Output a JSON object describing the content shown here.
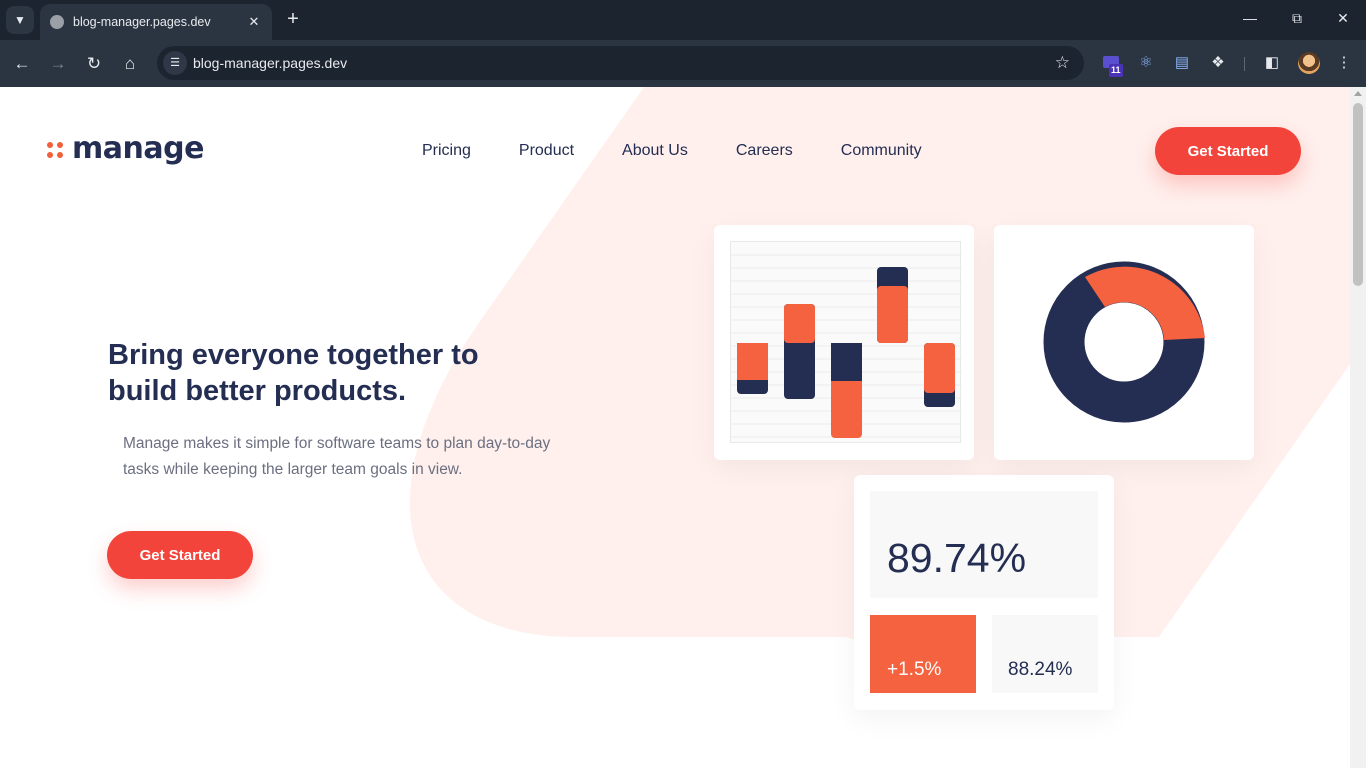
{
  "browser": {
    "tab_title": "blog-manager.pages.dev",
    "url": "blog-manager.pages.dev",
    "extension_badge": "11"
  },
  "header": {
    "logo_text": "manage",
    "nav": [
      "Pricing",
      "Product",
      "About Us",
      "Careers",
      "Community"
    ],
    "cta_label": "Get Started"
  },
  "hero": {
    "title": "Bring everyone together to build better products.",
    "description": "Manage makes it simple for software teams to plan day-to-day tasks while keeping the larger team goals in view.",
    "cta_label": "Get Started"
  },
  "metrics": {
    "main": "89.74%",
    "change": "+1.5%",
    "secondary": "88.24%"
  },
  "colors": {
    "accent": "#f2443a",
    "navy": "#242d52",
    "orange": "#f4623f",
    "peach_bg": "#fff0ed"
  }
}
